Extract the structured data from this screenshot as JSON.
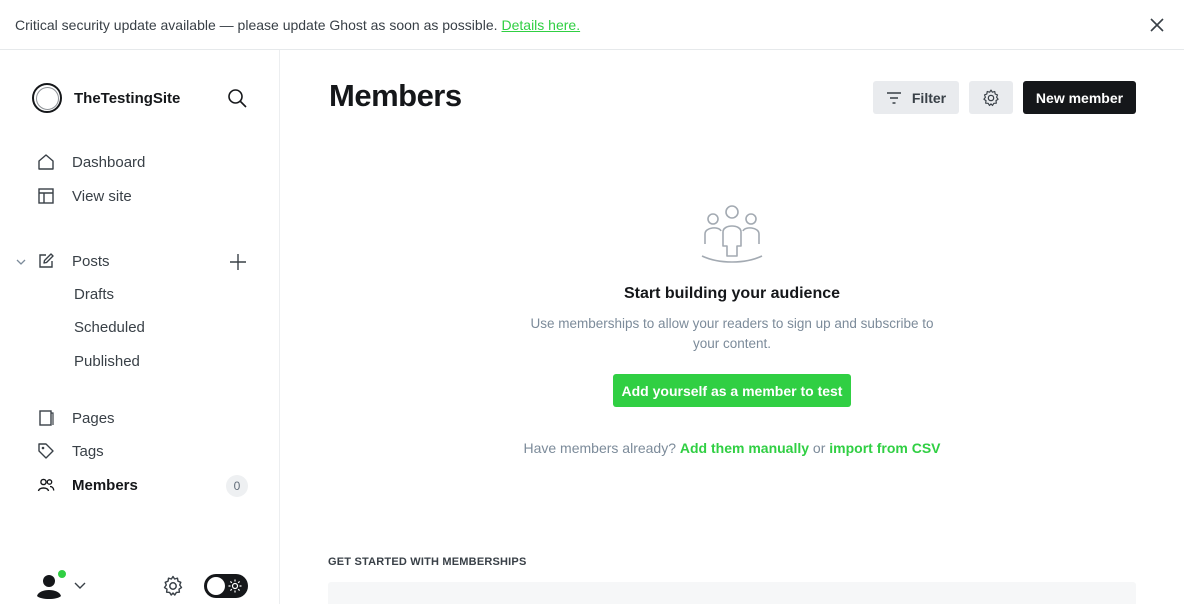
{
  "banner": {
    "message": "Critical security update available — please update Ghost as soon as possible.",
    "link_label": "Details here."
  },
  "sidebar": {
    "site_name": "TheTestingSite",
    "nav": [
      {
        "label": "Dashboard",
        "icon": "home-icon"
      },
      {
        "label": "View site",
        "icon": "layout-icon"
      }
    ],
    "posts": {
      "label": "Posts",
      "sub": [
        "Drafts",
        "Scheduled",
        "Published"
      ]
    },
    "lower": [
      {
        "label": "Pages",
        "icon": "page-icon"
      },
      {
        "label": "Tags",
        "icon": "tag-icon"
      },
      {
        "label": "Members",
        "icon": "members-icon",
        "active": true,
        "count": "0"
      }
    ]
  },
  "main": {
    "title": "Members",
    "filter_label": "Filter",
    "new_member_label": "New member",
    "empty": {
      "title": "Start building your audience",
      "description": "Use memberships to allow your readers to sign up and subscribe to your content.",
      "cta": "Add yourself as a member to test",
      "import_prefix": "Have members already?",
      "import_manual": "Add them manually",
      "import_or": "or",
      "import_csv": "import from CSV"
    },
    "section_heading": "GET STARTED WITH MEMBERSHIPS"
  },
  "colors": {
    "accent_green": "#30cf43",
    "dark": "#15171a",
    "muted": "#7c8b9a"
  }
}
